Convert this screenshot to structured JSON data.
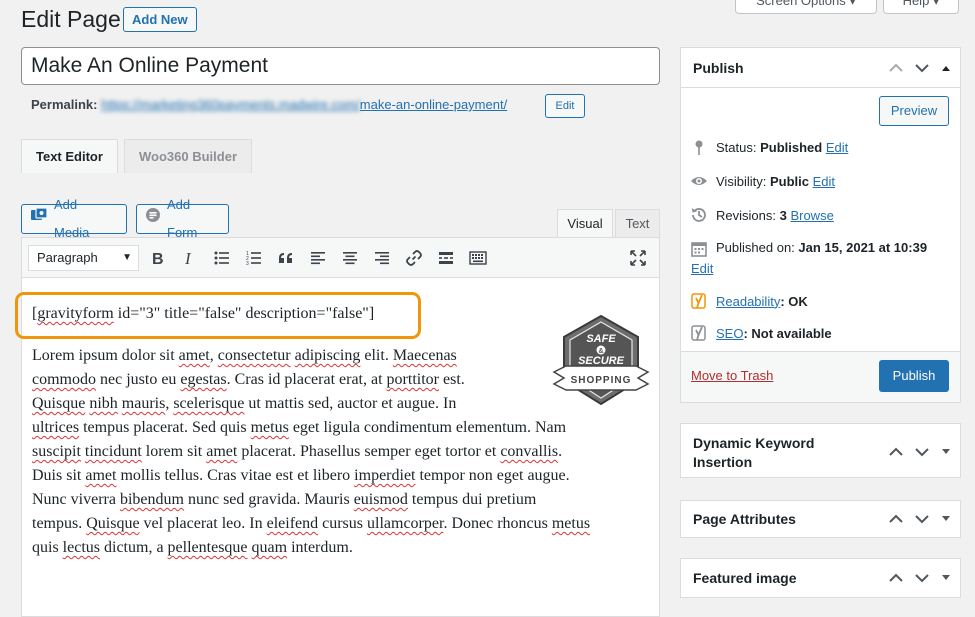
{
  "header": {
    "title": "Edit Page",
    "add_new": "Add New",
    "screen_options": "Screen Options ▾",
    "help": "Help ▾"
  },
  "post": {
    "title": "Make An Online Payment",
    "permalink_label": "Permalink:",
    "permalink_base": "https://marketing360payments.madwire.com/",
    "permalink_slug": "make-an-online-payment/",
    "permalink_edit": "Edit"
  },
  "builder_tabs": [
    "Text Editor",
    "Woo360 Builder"
  ],
  "media_buttons": {
    "add_media": "Add Media",
    "add_form": "Add Form"
  },
  "editor_modes": {
    "visual": "Visual",
    "text": "Text"
  },
  "toolbar": {
    "format_select": "Paragraph",
    "icons": [
      "bold-icon",
      "italic-icon",
      "bullet-list-icon",
      "numbered-list-icon",
      "blockquote-icon",
      "align-left-icon",
      "align-center-icon",
      "align-right-icon",
      "link-icon",
      "read-more-icon",
      "toolbar-toggle-icon",
      "fullscreen-icon"
    ]
  },
  "content": {
    "shortcode": "[gravityform id=\"3\" title=\"false\" description=\"false\"]",
    "badge_text_top": "SAFE",
    "badge_text_mid": "SECURE",
    "badge_text_bottom": "SHOPPING",
    "badge_amp": "&",
    "lines": [
      [
        [
          "Lorem ipsum dolor sit ",
          0
        ],
        [
          "amet",
          1
        ],
        [
          ", ",
          0
        ],
        [
          "consectetur",
          1
        ],
        [
          " ",
          0
        ],
        [
          "adipiscing",
          1
        ],
        [
          " elit. ",
          0
        ],
        [
          "Maecenas",
          1
        ]
      ],
      [
        [
          "commodo",
          1
        ],
        [
          " nec justo eu ",
          0
        ],
        [
          "egestas",
          1
        ],
        [
          ". Cras id placerat erat, at ",
          0
        ],
        [
          "porttitor",
          1
        ],
        [
          " est.",
          0
        ]
      ],
      [
        [
          "Quisque",
          1
        ],
        [
          " ",
          0
        ],
        [
          "nibh",
          1
        ],
        [
          " ",
          0
        ],
        [
          "mauris",
          1
        ],
        [
          ", ",
          0
        ],
        [
          "scelerisque",
          1
        ],
        [
          " ut mattis sed, auctor et augue. In",
          0
        ]
      ],
      [
        [
          "ultrices",
          1
        ],
        [
          " tempus placerat. Sed quis ",
          0
        ],
        [
          "metus",
          1
        ],
        [
          " eget ligula condimentum elementum. Nam",
          0
        ]
      ],
      [
        [
          "suscipit",
          1
        ],
        [
          " ",
          0
        ],
        [
          "tincidunt",
          1
        ],
        [
          " lorem sit ",
          0
        ],
        [
          "amet",
          1
        ],
        [
          " placerat. Phasellus semper eget tortor et ",
          0
        ],
        [
          "convallis",
          1
        ],
        [
          ".",
          0
        ]
      ],
      [
        [
          "Duis sit ",
          0
        ],
        [
          "amet",
          1
        ],
        [
          " mollis tellus. Cras vitae est et libero ",
          0
        ],
        [
          "imperdiet",
          1
        ],
        [
          " tempor non eget augue.",
          0
        ]
      ],
      [
        [
          "Nunc viverra ",
          0
        ],
        [
          "bibendum",
          1
        ],
        [
          " nunc sed gravida. Mauris ",
          0
        ],
        [
          "euismod",
          1
        ],
        [
          " tempus dui pretium",
          0
        ]
      ],
      [
        [
          "tempus. ",
          0
        ],
        [
          "Quisque",
          1
        ],
        [
          " vel placerat leo. In ",
          0
        ],
        [
          "eleifend",
          1
        ],
        [
          " cursus ",
          0
        ],
        [
          "ullamcorper",
          1
        ],
        [
          ". Donec rhoncus ",
          0
        ],
        [
          "metus",
          1
        ]
      ],
      [
        [
          "quis ",
          0
        ],
        [
          "lectus",
          1
        ],
        [
          " dictum, a ",
          0
        ],
        [
          "pellentesque",
          1
        ],
        [
          " ",
          0
        ],
        [
          "quam",
          1
        ],
        [
          " interdum.",
          0
        ]
      ]
    ]
  },
  "publish": {
    "title": "Publish",
    "preview": "Preview",
    "status_label": "Status:",
    "status_value": "Published",
    "visibility_label": "Visibility:",
    "visibility_value": "Public",
    "revisions_label": "Revisions:",
    "revisions_value": "3",
    "browse": "Browse",
    "published_on_label": "Published on:",
    "published_on_value": "Jan 15, 2021 at 10:39",
    "edit": "Edit",
    "readability_label": "Readability",
    "readability_value": ": OK",
    "seo_label": "SEO",
    "seo_value": ": Not available",
    "trash": "Move to Trash",
    "publish_button": "Publish"
  },
  "sidebar_boxes": {
    "dynamic_keyword": "Dynamic Keyword Insertion",
    "page_attributes": "Page Attributes",
    "featured_image": "Featured image"
  },
  "colors": {
    "accent": "#2271b1",
    "highlight": "#f0960a",
    "danger": "#b32d2e"
  }
}
